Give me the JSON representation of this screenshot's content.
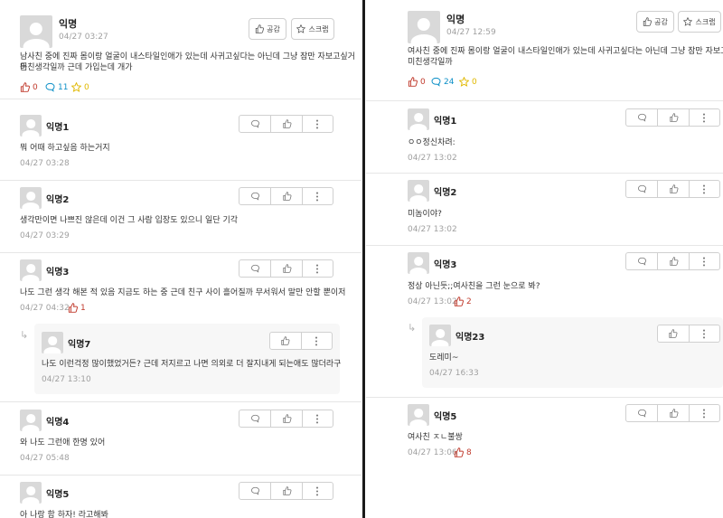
{
  "left": {
    "post": {
      "author": "익명",
      "time": "04/27 03:27",
      "like_label": "공감",
      "scrap_label": "스크랩",
      "body_line1": "남사친 중에 진짜 몸이랑 얼굴이 내스타일인애가 있는데 사귀고싶다는 아닌데 그냥 잠만 자보고싶거든",
      "body_line2": "미친생각일까 근데 가입는데 개가",
      "likes": "0",
      "comments": "11",
      "scraps": "0"
    },
    "comments": [
      {
        "author": "익명1",
        "text": "뭐 어때 하고싶음 하는거지",
        "time": "04/27 03:28"
      },
      {
        "author": "익명2",
        "text": "생각만이면 나쁘진 않은데 이건 그 사람 입장도 있으니 일단 기각",
        "time": "04/27 03:29"
      },
      {
        "author": "익명3",
        "text": "나도 그런 생각 해본 적 있음 지금도 하는 중 근데 친구 사이 흘어질까 무서워서 말만 안할 뿐이저",
        "time": "04/27 04:32",
        "likes": "1"
      },
      {
        "author": "익명4",
        "text": "와 나도 그런애 한명 있어",
        "time": "04/27 05:48"
      },
      {
        "author": "익명5",
        "text": "아 나랑 함 하자! 라고해봐"
      }
    ],
    "reply": {
      "author": "익명7",
      "text": "나도 이런걱정 많이했었거든? 근데 저지르고 나면 의외로 더 잘지내게 되는애도 많더라구",
      "time": "04/27 13:10"
    }
  },
  "right": {
    "post": {
      "author": "익명",
      "time": "04/27 12:59",
      "like_label": "공감",
      "scrap_label": "스크랩",
      "body_line1": "여사친 중에 진짜 몸이랑 얼굴이 내스타일인애가 있는데 사귀고싶다는 아닌데 그냥 잠만 자보고싶거든",
      "body_line2": "미친생각일까",
      "likes": "0",
      "comments": "24",
      "scraps": "0"
    },
    "comments": [
      {
        "author": "익명1",
        "text": "ㅇㅇ정신차려:",
        "time": "04/27 13:02"
      },
      {
        "author": "익명2",
        "text": "미놈이야?",
        "time": "04/27 13:02"
      },
      {
        "author": "익명3",
        "text": "정상 아닌듯;;여사친을 그런 눈으로 봐?",
        "time": "04/27 13:02",
        "likes": "2"
      },
      {
        "author": "익명5",
        "text": "여사친 ㅈㄴ불쌍",
        "time": "04/27 13:06",
        "likes": "8"
      }
    ],
    "reply": {
      "author": "익명23",
      "text": "도레미~",
      "time": "04/27 16:33"
    }
  },
  "icons": {
    "like": "thumbs-up-icon",
    "comment": "speech-bubble-icon",
    "scrap": "star-icon",
    "more": "vertical-dots-icon",
    "reply": "reply-arrow-icon"
  },
  "colors": {
    "like": "#c0392b",
    "comment": "#0c8fc7",
    "scrap": "#e0b800",
    "divider": "#1a1a1a"
  }
}
